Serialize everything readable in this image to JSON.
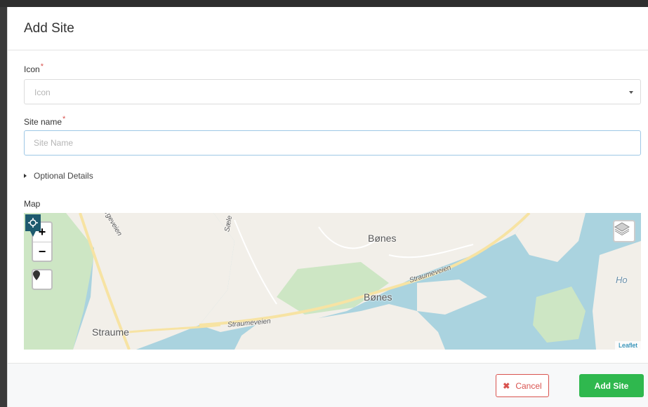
{
  "modal": {
    "title": "Add Site"
  },
  "form": {
    "icon_label": "Icon",
    "icon_required": "*",
    "icon_placeholder": "Icon",
    "site_name_label": "Site name",
    "site_name_required": "*",
    "site_name_placeholder": "Site Name",
    "site_name_value": "",
    "optional_details_label": "Optional Details",
    "map_label": "Map"
  },
  "map": {
    "zoom_in": "+",
    "zoom_out": "−",
    "places": {
      "bones_top": "Bønes",
      "bones_bottom": "Bønes",
      "straume": "Straume",
      "ho": "Ho"
    },
    "roads": {
      "straumeveien_left": "Straumeveien",
      "straumeveien_right": "Straumeveien",
      "road_top_left": "rgeveien",
      "road_top_mid": "Sæle"
    },
    "attribution": "Leaflet",
    "colors": {
      "water": "#aad3df",
      "land": "#f2efe9",
      "park": "#cde6c4",
      "road": "#f7e3a3",
      "marker": "#1e5a6e"
    }
  },
  "footer": {
    "cancel_label": "Cancel",
    "add_label": "Add Site"
  },
  "icons": {
    "cancel": "close-icon",
    "marker_tool": "map-marker-icon",
    "layers": "layers-icon",
    "pin": "map-pin-icon",
    "select_caret": "caret-down-icon",
    "details_toggle": "triangle-right-icon"
  }
}
